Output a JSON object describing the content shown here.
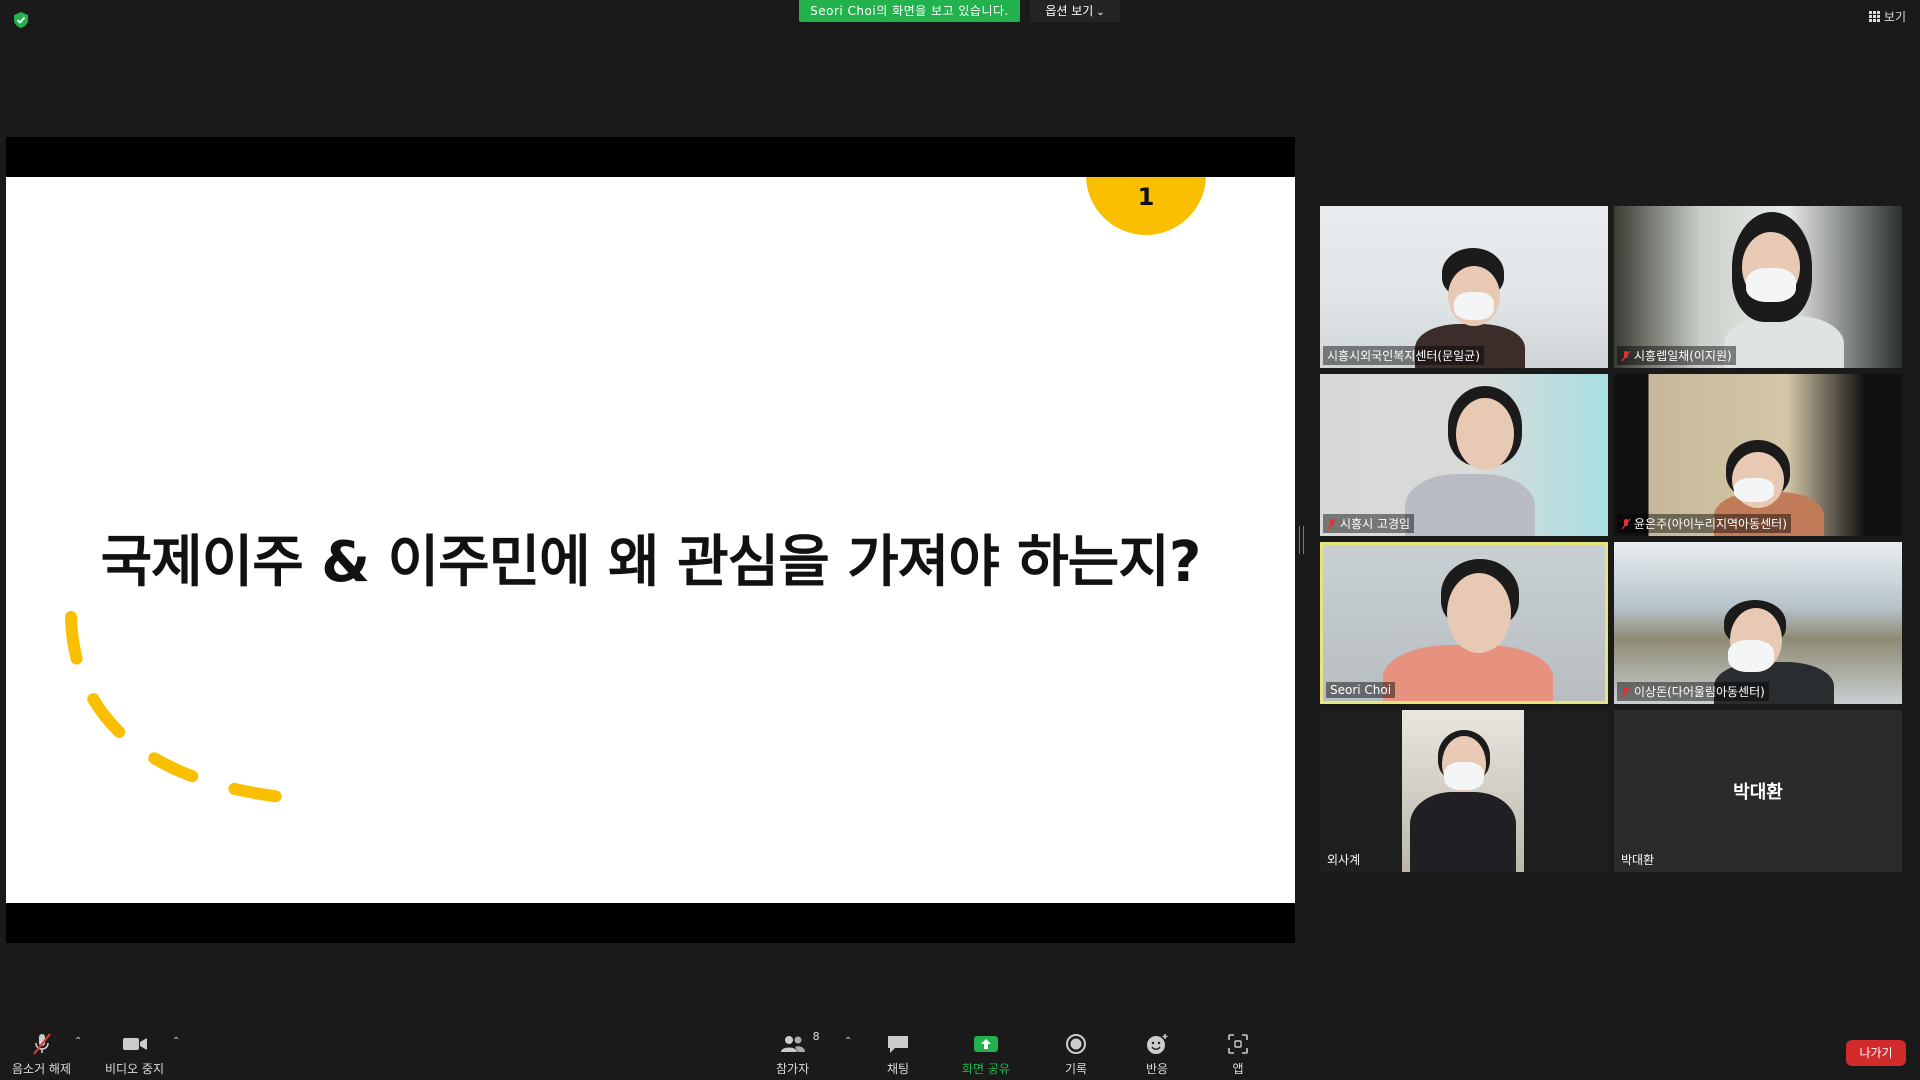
{
  "top": {
    "banner": "Seori Choi의 화면을 보고 있습니다.",
    "view_options": "옵션 보기",
    "view": "보기"
  },
  "slide": {
    "page_number": "1",
    "title": "국제이주 & 이주민에 왜 관심을 가져야 하는지?"
  },
  "participants": [
    {
      "name": "시흥시외국인복지센터(문일균)",
      "muted": false
    },
    {
      "name": "시흥렙일채(이지원)",
      "muted": true
    },
    {
      "name": "시흥시 고경임",
      "muted": true
    },
    {
      "name": "윤은주(아이누리지역아동센터)",
      "muted": true
    },
    {
      "name": "Seori Choi",
      "muted": false,
      "active": true
    },
    {
      "name": "이상돈(다어울림아동센터)",
      "muted": true
    },
    {
      "name": "외사계",
      "muted": false
    },
    {
      "name": "박대환",
      "muted": false,
      "no_video": true
    }
  ],
  "toolbar": {
    "unmute": "음소거 해제",
    "stop_video": "비디오 중지",
    "participants": "참가자",
    "participants_count": "8",
    "chat": "채팅",
    "share_screen": "화면 공유",
    "record": "기록",
    "reactions": "반응",
    "apps": "앱",
    "leave": "나가기"
  },
  "colors": {
    "share_green": "#23b14d",
    "slide_accent": "#f9bf00",
    "active_speaker": "#e4e67b",
    "leave_red": "#d22b2b"
  }
}
